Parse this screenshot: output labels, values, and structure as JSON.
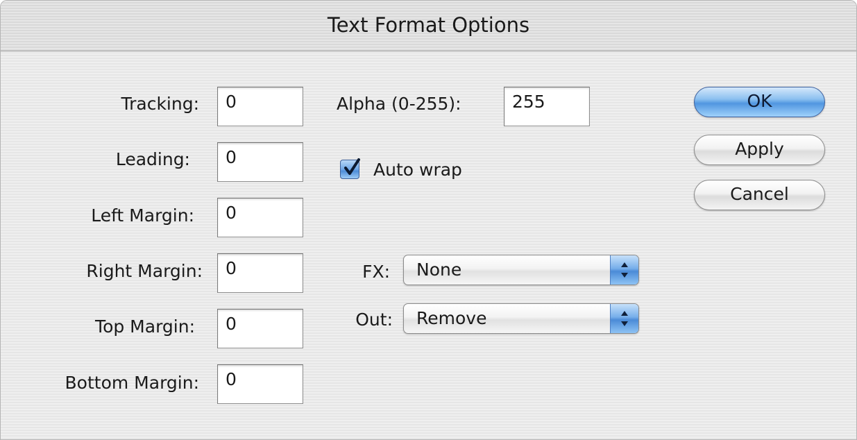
{
  "window": {
    "title": "Text Format Options"
  },
  "fields": {
    "tracking": {
      "label": "Tracking:",
      "value": "0"
    },
    "leading": {
      "label": "Leading:",
      "value": "0"
    },
    "left_margin": {
      "label": "Left Margin:",
      "value": "0"
    },
    "right_margin": {
      "label": "Right Margin:",
      "value": "0"
    },
    "top_margin": {
      "label": "Top Margin:",
      "value": "0"
    },
    "bottom_margin": {
      "label": "Bottom Margin:",
      "value": "0"
    },
    "alpha": {
      "label": "Alpha (0-255):",
      "value": "255"
    }
  },
  "auto_wrap": {
    "label": "Auto wrap",
    "checked": true
  },
  "popups": {
    "fx": {
      "label": "FX:",
      "value": "None"
    },
    "out": {
      "label": "Out:",
      "value": "Remove"
    }
  },
  "buttons": {
    "ok": "OK",
    "apply": "Apply",
    "cancel": "Cancel"
  },
  "colors": {
    "accent": "#5196e0",
    "window_bg": "#ececec"
  },
  "icons": {
    "checkbox": "checkmark-icon",
    "popup": "up-down-arrows-icon"
  }
}
